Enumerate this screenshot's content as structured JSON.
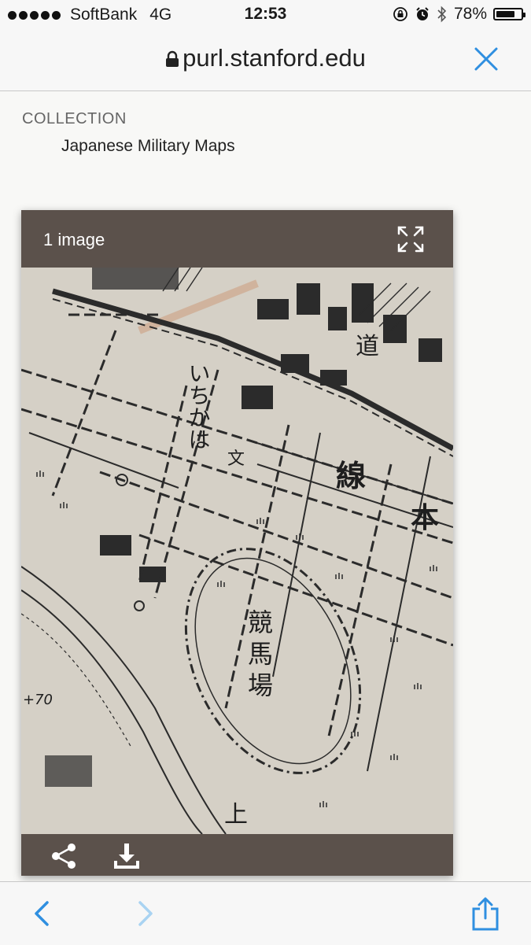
{
  "status_bar": {
    "carrier": "SoftBank",
    "network": "4G",
    "time": "12:53",
    "battery": "78%",
    "battery_level": 0.78
  },
  "address_bar": {
    "url": "purl.stanford.edu"
  },
  "collection": {
    "label": "COLLECTION",
    "name": "Japanese Military Maps"
  },
  "viewer": {
    "image_count": "1 image",
    "map_labels": [
      "いちかは",
      "線",
      "本",
      "競",
      "馬",
      "場",
      "文",
      "道",
      "上",
      "+70"
    ]
  },
  "colors": {
    "accent": "#2f8fe0",
    "viewer_bg": "#5b514b",
    "map_paper": "#d5d0c6",
    "map_ink": "#2b2b2b"
  }
}
